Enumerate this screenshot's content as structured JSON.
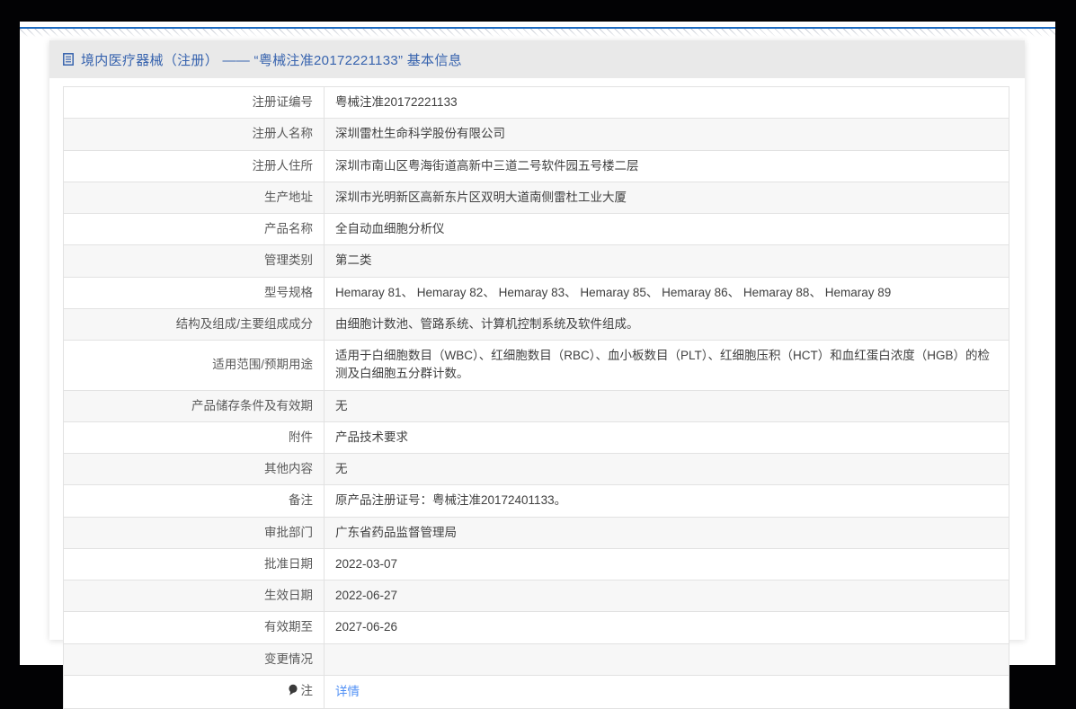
{
  "header": {
    "icon": "document-icon",
    "title": "境内医疗器械（注册） —— “粤械注准20172221133” 基本信息"
  },
  "table": {
    "rows": [
      {
        "label": "注册证编号",
        "value": "粤械注准20172221133"
      },
      {
        "label": "注册人名称",
        "value": "深圳雷杜生命科学股份有限公司"
      },
      {
        "label": "注册人住所",
        "value": "深圳市南山区粤海街道高新中三道二号软件园五号楼二层"
      },
      {
        "label": "生产地址",
        "value": "深圳市光明新区高新东片区双明大道南侧雷杜工业大厦"
      },
      {
        "label": "产品名称",
        "value": "全自动血细胞分析仪"
      },
      {
        "label": "管理类别",
        "value": "第二类"
      },
      {
        "label": "型号规格",
        "value": "Hemaray 81、 Hemaray 82、 Hemaray 83、 Hemaray 85、 Hemaray 86、 Hemaray 88、 Hemaray 89"
      },
      {
        "label": "结构及组成/主要组成成分",
        "value": "由细胞计数池、管路系统、计算机控制系统及软件组成。"
      },
      {
        "label": "适用范围/预期用途",
        "value": "适用于白细胞数目（WBC）、红细胞数目（RBC）、血小板数目（PLT）、红细胞压积（HCT）和血红蛋白浓度（HGB）的检测及白细胞五分群计数。"
      },
      {
        "label": "产品储存条件及有效期",
        "value": "无"
      },
      {
        "label": "附件",
        "value": "产品技术要求"
      },
      {
        "label": "其他内容",
        "value": "无"
      },
      {
        "label": "备注",
        "value": "原产品注册证号：粤械注准20172401133。"
      },
      {
        "label": "审批部门",
        "value": "广东省药品监督管理局"
      },
      {
        "label": "批准日期",
        "value": "2022-03-07"
      },
      {
        "label": "生效日期",
        "value": "2022-06-27"
      },
      {
        "label": "有效期至",
        "value": "2027-06-26"
      },
      {
        "label": "变更情况",
        "value": ""
      },
      {
        "label": "注",
        "label_icon": "note-icon",
        "value": "详情",
        "link": true
      }
    ]
  },
  "colors": {
    "top_accent_blue": "#1e6bbf",
    "title_blue": "#3763ae",
    "link_blue": "#4f8ff5",
    "titlebar_bg": "#e9e9e9",
    "frame_black": "#020204"
  }
}
